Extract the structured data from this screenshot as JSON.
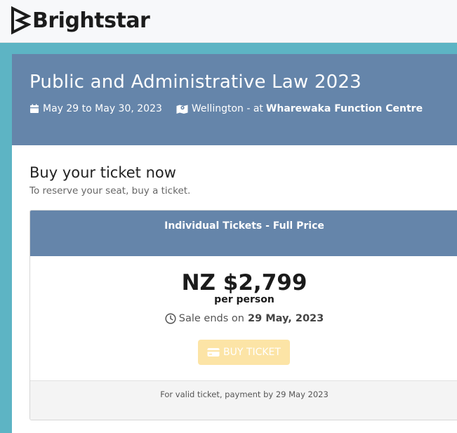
{
  "brand": {
    "name": "Brightstar",
    "icon": "brightstar-logo-icon"
  },
  "event": {
    "title": "Public and Administrative Law 2023",
    "dates": "May 29 to May 30, 2023",
    "city": "Wellington - at",
    "venue": "Wharewaka Function Centre",
    "calendar_icon": "calendar-icon",
    "map_icon": "map-icon"
  },
  "purchase": {
    "heading": "Buy your ticket now",
    "subheading": "To reserve your seat, buy a ticket."
  },
  "ticket": {
    "name": "Individual Tickets - Full Price",
    "price": "NZ $2,799",
    "unit": "per person",
    "sale_ends_label": "Sale ends on",
    "sale_ends_date": "29 May, 2023",
    "buy_label": "BUY TICKET",
    "buy_icon": "credit-card-icon",
    "clock_icon": "clock-icon",
    "footer_note": "For valid ticket, payment by 29 May 2023"
  },
  "colors": {
    "page_background": "#5db4c4",
    "header_blue": "#6585aa",
    "buy_button": "#fce4a6"
  }
}
